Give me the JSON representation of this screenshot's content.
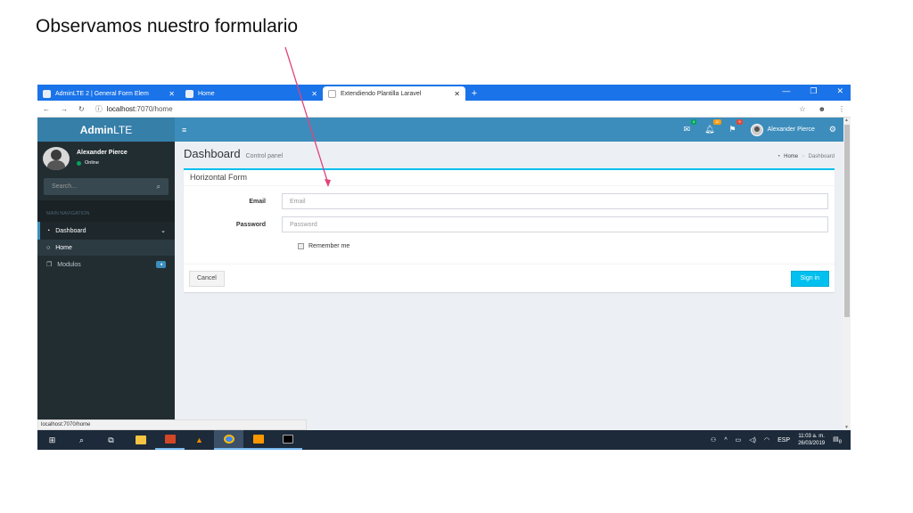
{
  "slide": {
    "title": "Observamos nuestro formulario"
  },
  "browser": {
    "tabs": [
      {
        "label": "AdminLTE 2 | General Form Elem"
      },
      {
        "label": "Home"
      },
      {
        "label": "Extendiendo Plantilla Laravel"
      }
    ],
    "url_host": "localhost",
    "url_path": ":7070/home",
    "status_url": "localhost:7070/home"
  },
  "admin": {
    "logo_bold": "Admin",
    "logo_rest": "LTE",
    "user_name": "Alexander Pierce",
    "user_status": "Online",
    "nav_badges": {
      "mail": "4",
      "bell": "10",
      "flag": "9"
    },
    "search_placeholder": "Search...",
    "sidebar_header": "MAIN NAVIGATION",
    "menu": {
      "dashboard": "Dashboard",
      "home": "Home",
      "modulos": "Modulos"
    },
    "content_title": "Dashboard",
    "content_subtitle": "Control panel",
    "breadcrumb": {
      "home": "Home",
      "sep": ">",
      "current": "Dashboard"
    }
  },
  "form": {
    "title": "Horizontal Form",
    "email_label": "Email",
    "email_placeholder": "Email",
    "password_label": "Password",
    "password_placeholder": "Password",
    "remember_label": "Remember me",
    "cancel_label": "Cancel",
    "signin_label": "Sign in"
  },
  "taskbar": {
    "lang": "ESP",
    "time": "11:03 a. m.",
    "date": "26/03/2019",
    "notif_count": "8"
  },
  "colors": {
    "navbar": "#3c8dbc",
    "logo_bg": "#367fa9",
    "sidebar": "#222d32",
    "box_accent": "#00c0ef",
    "browser_tabs": "#1a73e8",
    "arrow": "#e0447a"
  }
}
